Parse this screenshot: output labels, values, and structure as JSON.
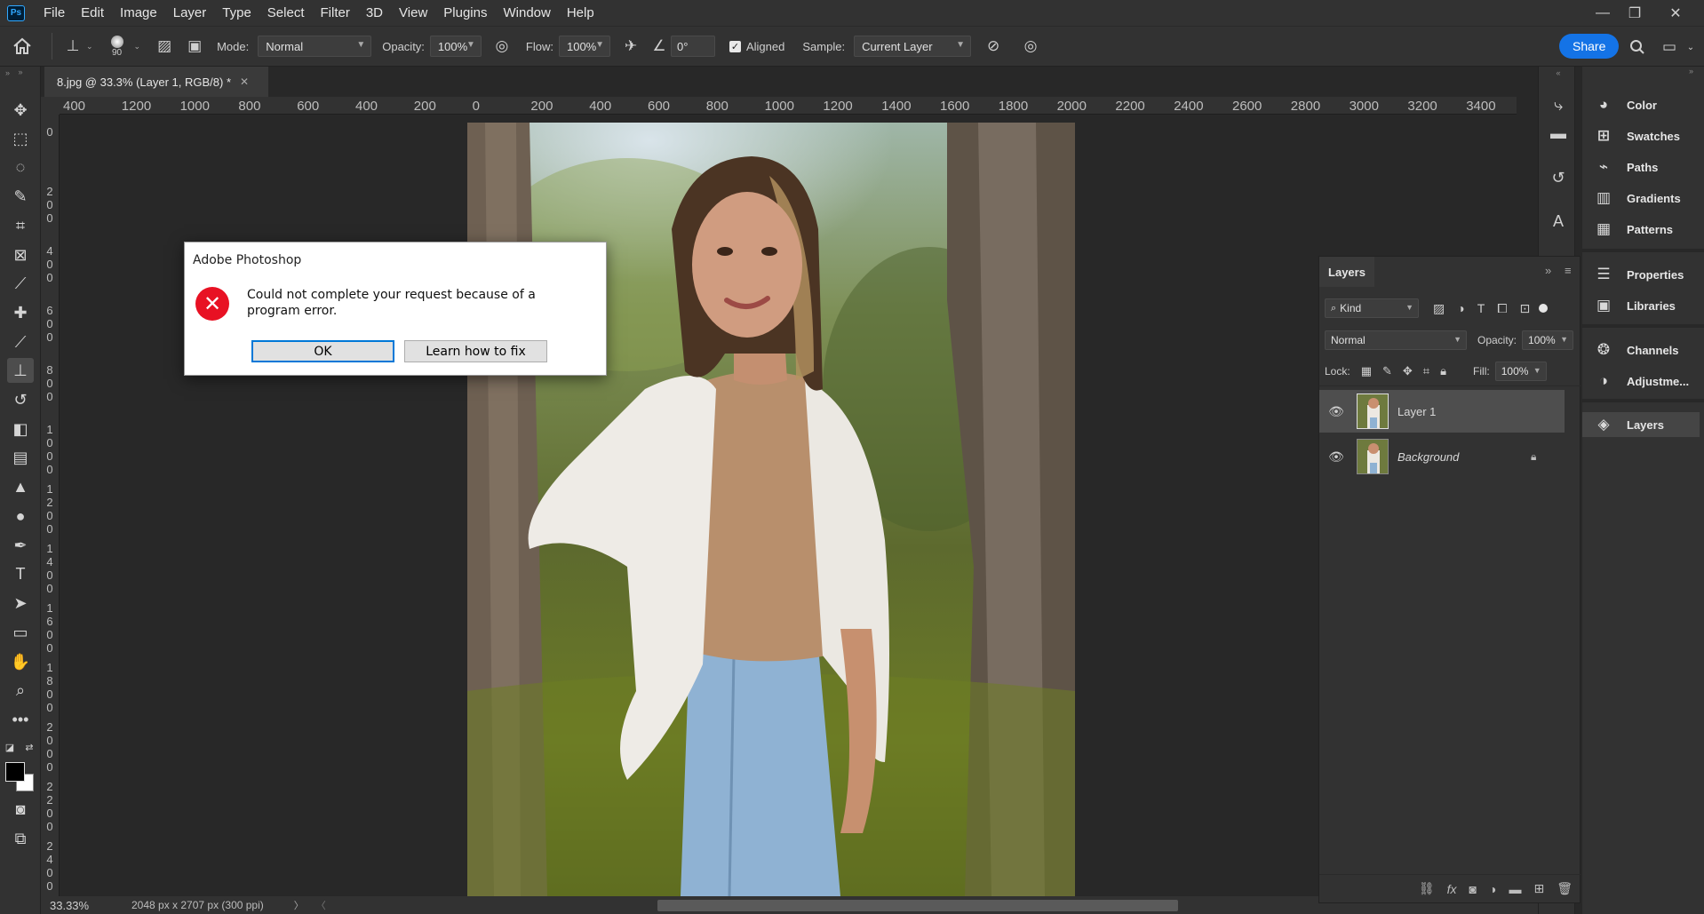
{
  "app": {
    "logo_text": "Ps",
    "menu": [
      "File",
      "Edit",
      "Image",
      "Layer",
      "Type",
      "Select",
      "Filter",
      "3D",
      "View",
      "Plugins",
      "Window",
      "Help"
    ]
  },
  "options_bar": {
    "brush_size": "90",
    "mode_label": "Mode:",
    "mode_value": "Normal",
    "opacity_label": "Opacity:",
    "opacity_value": "100%",
    "flow_label": "Flow:",
    "flow_value": "100%",
    "angle_value": "0°",
    "aligned_label": "Aligned",
    "sample_label": "Sample:",
    "sample_value": "Current Layer",
    "share_label": "Share"
  },
  "document": {
    "tab_title": "8.jpg @ 33.3% (Layer 1, RGB/8) *",
    "ruler_h": [
      "400",
      "1200",
      "1000",
      "800",
      "600",
      "400",
      "200",
      "0",
      "200",
      "400",
      "600",
      "800",
      "1000",
      "1200",
      "1400",
      "1600",
      "1800",
      "2000",
      "2200",
      "2400",
      "2600",
      "2800",
      "3000",
      "3200",
      "3400"
    ],
    "ruler_v": [
      "0",
      "2\n0\n0",
      "4\n0\n0",
      "6\n0\n0",
      "8\n0\n0",
      "1\n0\n0\n0",
      "1\n2\n0\n0",
      "1\n4\n0\n0",
      "1\n6\n0\n0",
      "1\n8\n0\n0",
      "2\n0\n0\n0",
      "2\n2\n0\n0",
      "2\n4\n0\n0"
    ]
  },
  "status_bar": {
    "zoom": "33.33%",
    "doc_info": "2048 px x 2707 px (300 ppi)"
  },
  "dialog": {
    "title": "Adobe Photoshop",
    "message": "Could not complete your request because of a program error.",
    "ok_label": "OK",
    "learn_label": "Learn how to fix"
  },
  "right_panels": [
    {
      "label": "Color",
      "icon": "palette-icon"
    },
    {
      "label": "Swatches",
      "icon": "grid-icon"
    },
    {
      "label": "Paths",
      "icon": "pen-path-icon"
    },
    {
      "label": "Gradients",
      "icon": "gradient-icon"
    },
    {
      "label": "Patterns",
      "icon": "pattern-icon"
    },
    {
      "label": "Properties",
      "icon": "sliders-icon"
    },
    {
      "label": "Libraries",
      "icon": "library-icon"
    },
    {
      "label": "Channels",
      "icon": "channels-icon"
    },
    {
      "label": "Adjustme...",
      "icon": "adjustments-icon"
    },
    {
      "label": "Layers",
      "icon": "layers-icon"
    }
  ],
  "layers_panel": {
    "tab_label": "Layers",
    "filter_label": "Kind",
    "blend_mode": "Normal",
    "opacity_label": "Opacity:",
    "opacity_value": "100%",
    "lock_label": "Lock:",
    "fill_label": "Fill:",
    "fill_value": "100%",
    "layers": [
      {
        "name": "Layer 1",
        "selected": true,
        "locked": false
      },
      {
        "name": "Background",
        "selected": false,
        "locked": true
      }
    ]
  }
}
